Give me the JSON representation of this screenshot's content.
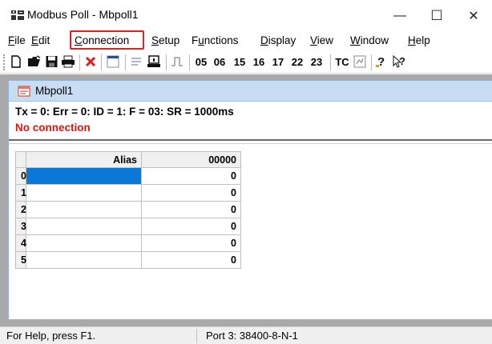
{
  "window": {
    "title": "Modbus Poll - Mbpoll1",
    "minimize": "—",
    "maximize": "☐",
    "close": "✕"
  },
  "menu": [
    {
      "key": "F",
      "rest": "ile"
    },
    {
      "key": "E",
      "rest": "dit"
    },
    {
      "key": "C",
      "rest": "onnection"
    },
    {
      "key": "S",
      "rest": "etup"
    },
    {
      "key": "",
      "pre": "F",
      "key2": "u",
      "rest": "nctions"
    },
    {
      "key": "D",
      "rest": "isplay"
    },
    {
      "key": "V",
      "rest": "iew"
    },
    {
      "key": "W",
      "rest": "indow"
    },
    {
      "key": "H",
      "rest": "elp"
    }
  ],
  "toolbar": {
    "function_codes": [
      "05",
      "06",
      "15",
      "16",
      "17",
      "22",
      "23"
    ],
    "tc_label": "TC"
  },
  "child": {
    "title": "Mbpoll1",
    "status": "Tx = 0: Err = 0: ID = 1: F = 03: SR = 1000ms",
    "connection": "No connection"
  },
  "grid": {
    "headers": [
      "Alias",
      "00000"
    ],
    "rows": [
      {
        "index": "0",
        "alias": "",
        "value": "0"
      },
      {
        "index": "1",
        "alias": "",
        "value": "0"
      },
      {
        "index": "2",
        "alias": "",
        "value": "0"
      },
      {
        "index": "3",
        "alias": "",
        "value": "0"
      },
      {
        "index": "4",
        "alias": "",
        "value": "0"
      },
      {
        "index": "5",
        "alias": "",
        "value": "0"
      }
    ]
  },
  "statusbar": {
    "help": "For Help, press F1.",
    "port": "Port 3: 38400-8-N-1"
  },
  "colors": {
    "highlight_box": "#e0201b",
    "connection_text": "#e0140c",
    "selected_cell": "#0a78d7"
  }
}
